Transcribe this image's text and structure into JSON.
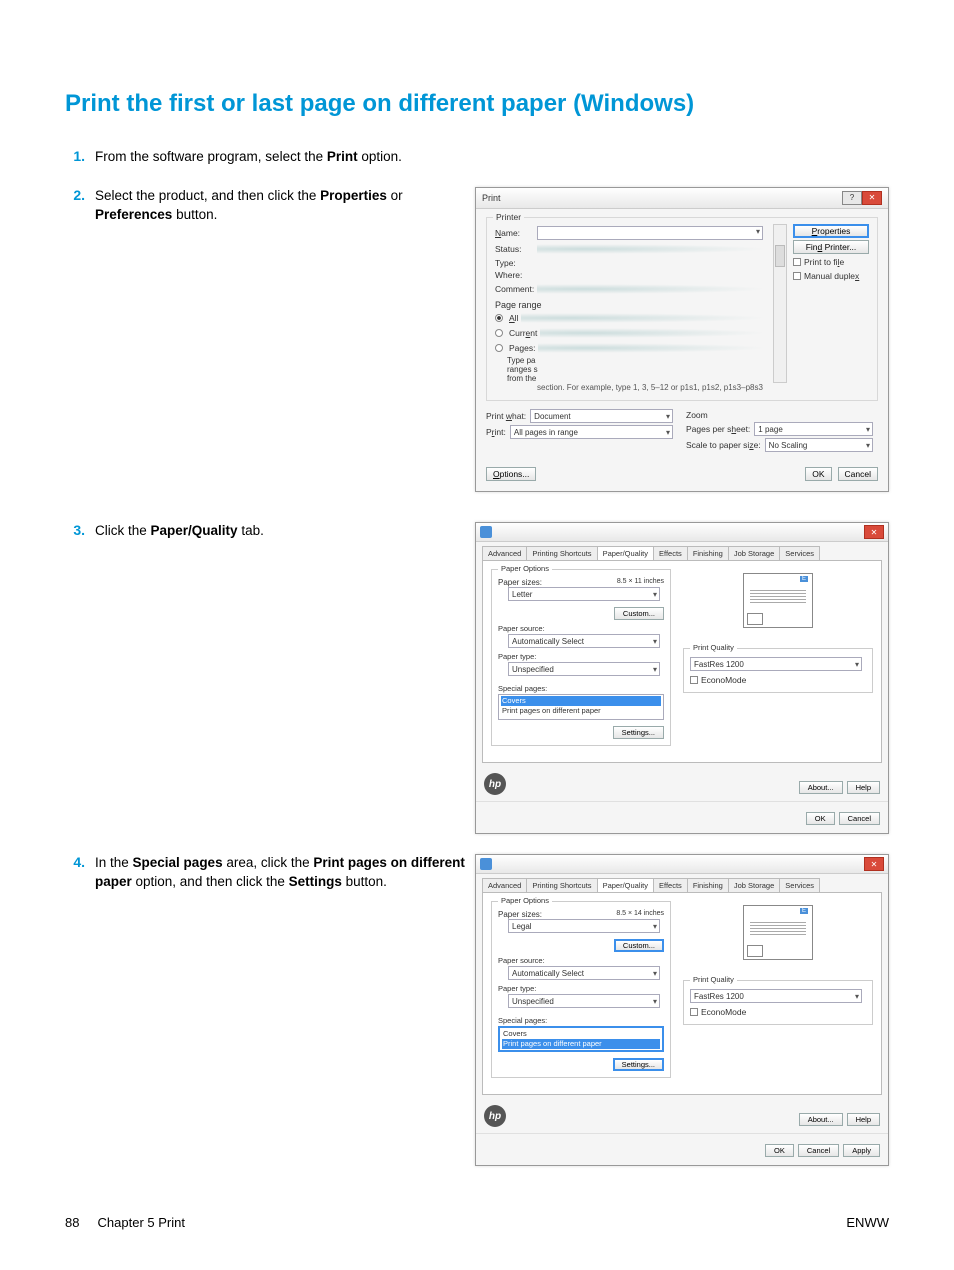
{
  "page": {
    "title": "Print the first or last page on different paper (Windows)",
    "footer_left_page": "88",
    "footer_left_text": "Chapter 5   Print",
    "footer_right": "ENWW"
  },
  "steps": {
    "s1": {
      "num": "1.",
      "pre": "From the software program, select the ",
      "bold": "Print",
      "post": " option."
    },
    "s2": {
      "num": "2.",
      "pre": "Select the product, and then click the ",
      "bold1": "Properties",
      "mid": " or ",
      "bold2": "Preferences",
      "post": " button."
    },
    "s3": {
      "num": "3.",
      "pre": "Click the ",
      "bold": "Paper/Quality",
      "post": " tab."
    },
    "s4": {
      "num": "4.",
      "pre": "In the ",
      "bold1": "Special pages",
      "mid1": " area, click the ",
      "bold2": "Print pages on different paper",
      "mid2": " option, and then click the ",
      "bold3": "Settings",
      "post": " button."
    }
  },
  "printDialog": {
    "title": "Print",
    "groupPrinter": "Printer",
    "name": "Name:",
    "status": "Status:",
    "type": "Type:",
    "where": "Where:",
    "comment": "Comment:",
    "properties": "Properties",
    "findPrinter": "Find Printer...",
    "printToFile": "Print to file",
    "manualDuplex": "Manual duplex",
    "groupPageRange": "Page range",
    "all": "All",
    "current": "Current page",
    "pages": "Pages:",
    "typePages": "Type pages",
    "rangesS": "ranges s",
    "fromThe": "from the",
    "sectionNote": "section. For example, type 1, 3, 5–12 or p1s1, p1s2, p1s3–p8s3",
    "printWhat": "Print what:",
    "printWhatVal": "Document",
    "printRange": "Print:",
    "printRangeVal": "All pages in range",
    "zoom": "Zoom",
    "pps": "Pages per sheet:",
    "ppsVal": "1 page",
    "scaleTo": "Scale to paper size:",
    "scaleToVal": "No Scaling",
    "options": "Options...",
    "ok": "OK",
    "cancel": "Cancel"
  },
  "propsDialog": {
    "tabs": [
      "Advanced",
      "Printing Shortcuts",
      "Paper/Quality",
      "Effects",
      "Finishing",
      "Job Storage",
      "Services"
    ],
    "paperOptions": "Paper Options",
    "paperSizes": "Paper sizes:",
    "paperSizeNote1": "8.5 × 11 inches",
    "paperSizeNote2": "8.5 × 14 inches",
    "paperSizeVal1": "Letter",
    "paperSizeVal2": "Legal",
    "custom": "Custom...",
    "paperSource": "Paper source:",
    "paperSourceVal": "Automatically Select",
    "paperType": "Paper type:",
    "paperTypeVal": "Unspecified",
    "specialPages": "Special pages:",
    "spCovers": "Covers",
    "spDiff": "Print pages on different paper",
    "settings": "Settings...",
    "printQuality": "Print Quality",
    "pqVal": "FastRes 1200",
    "econoMode": "EconoMode",
    "about": "About...",
    "help": "Help",
    "ok": "OK",
    "cancel": "Cancel",
    "apply": "Apply"
  }
}
